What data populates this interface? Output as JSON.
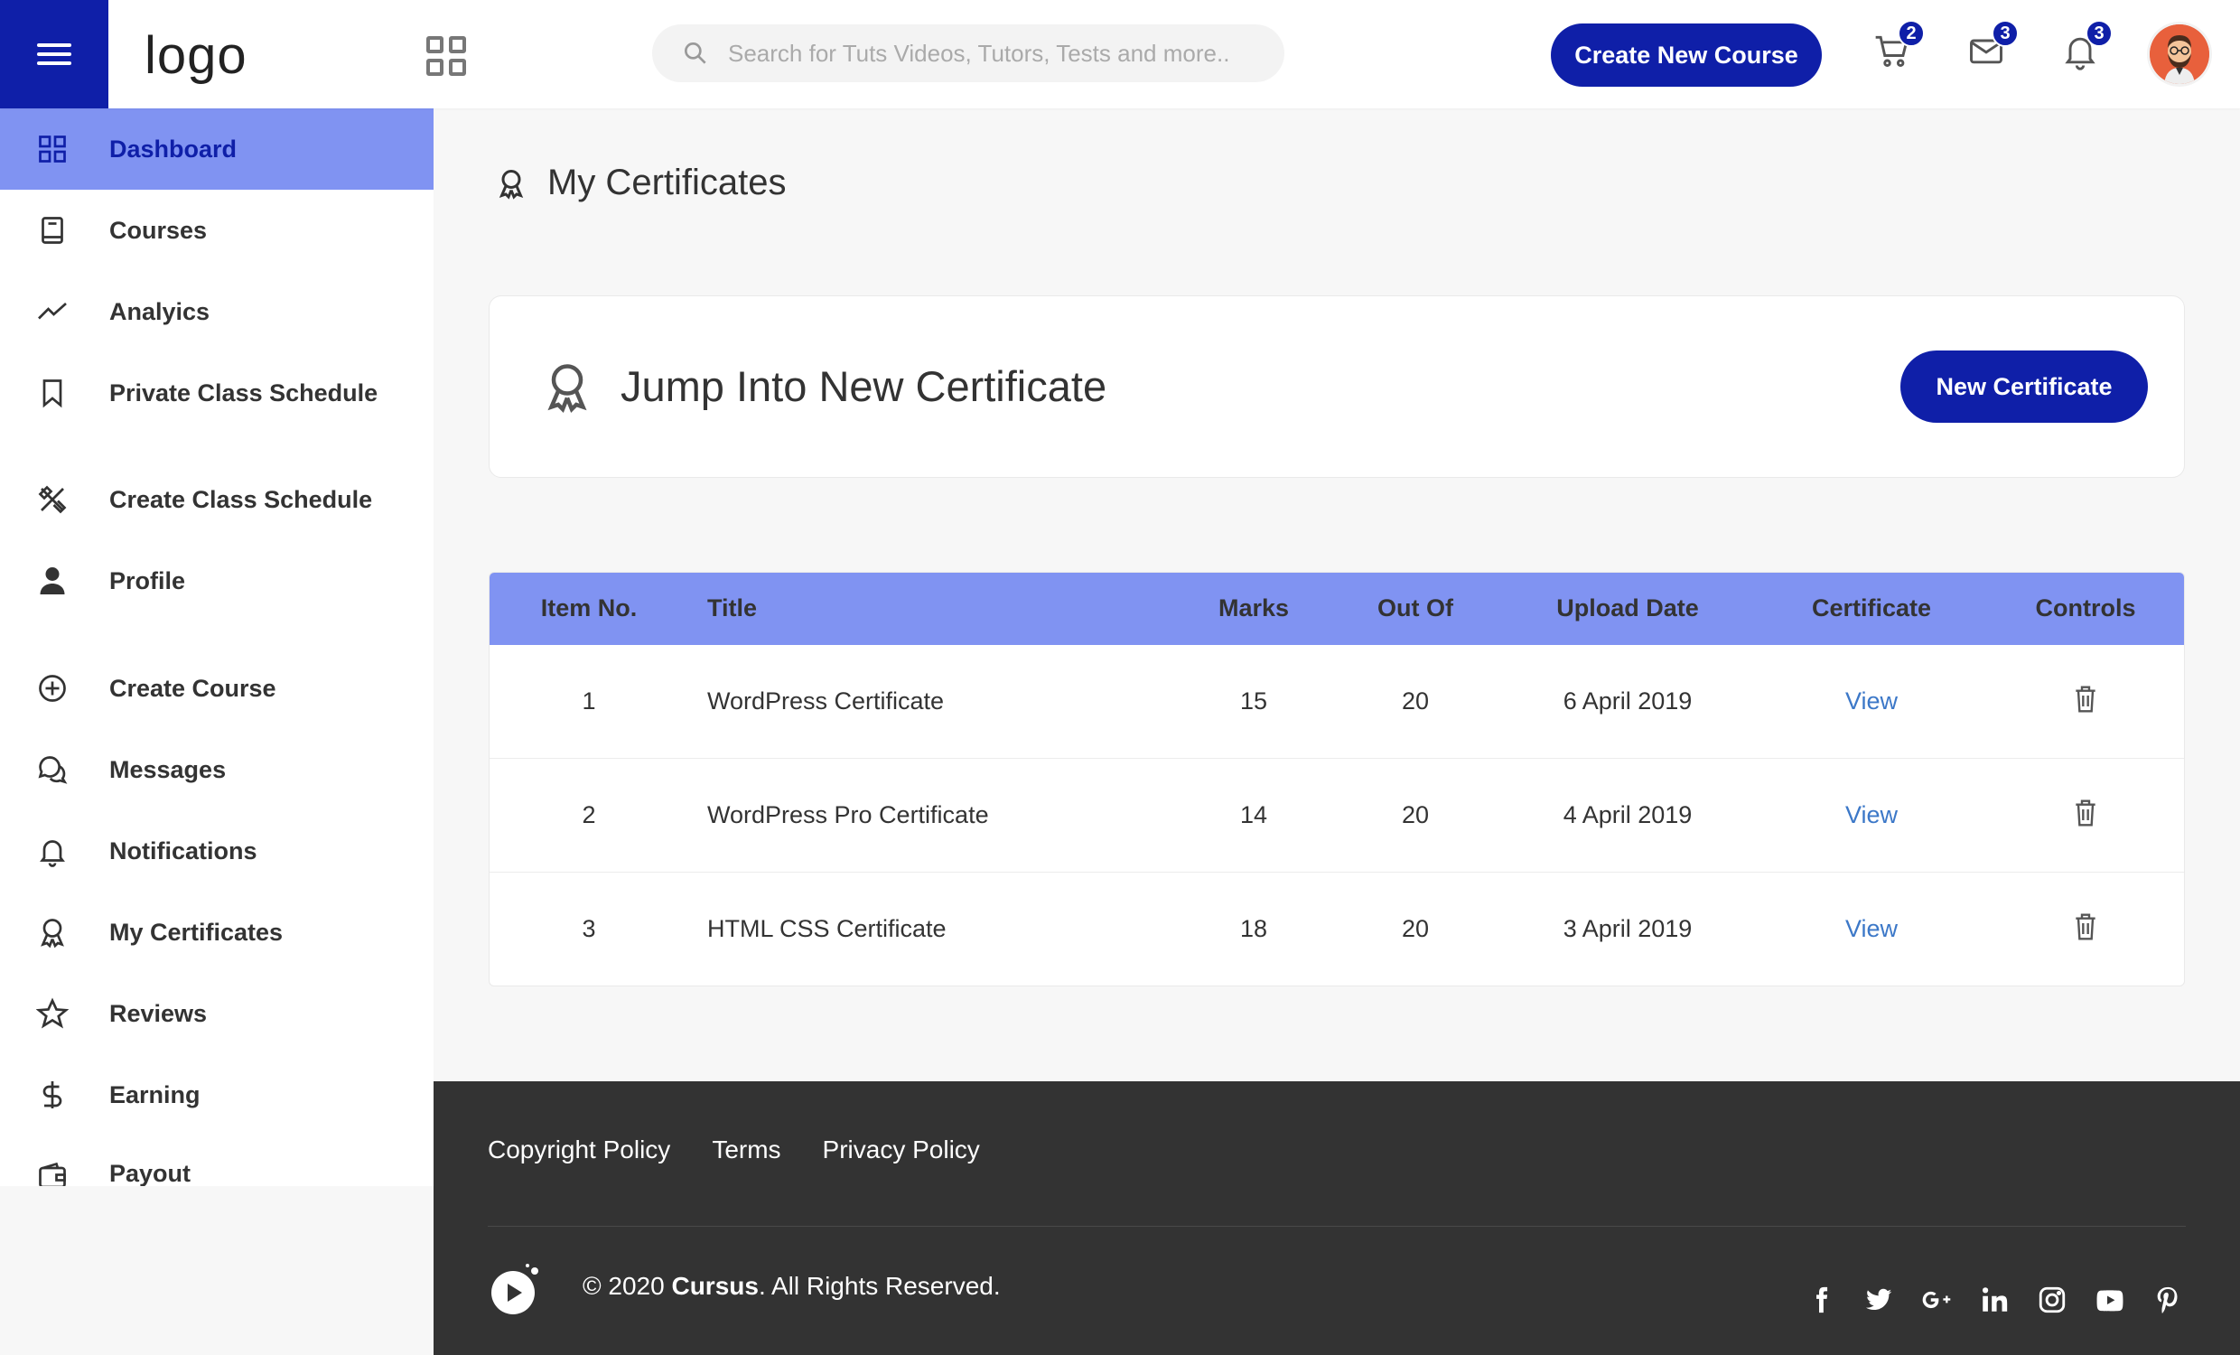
{
  "header": {
    "logo_text": "logo",
    "search_placeholder": "Search for Tuts Videos, Tutors, Tests and more..",
    "create_button": "Create New Course",
    "cart_badge": "2",
    "messages_badge": "3",
    "notifications_badge": "3"
  },
  "sidebar": {
    "items": [
      {
        "label": "Dashboard",
        "icon": "dashboard-icon",
        "active": true
      },
      {
        "label": "Courses",
        "icon": "book-icon"
      },
      {
        "label": "Analyics",
        "icon": "trend-icon"
      },
      {
        "label": "Private Class Schedule",
        "icon": "bookmark-icon"
      },
      {
        "label": "Create Class Schedule",
        "icon": "pen-ruler-icon"
      },
      {
        "label": "Profile",
        "icon": "user-icon"
      },
      {
        "label": "Create Course",
        "icon": "plus-circle-icon"
      },
      {
        "label": "Messages",
        "icon": "chat-icon"
      },
      {
        "label": "Notifications",
        "icon": "bell-icon"
      },
      {
        "label": "My Certificates",
        "icon": "award-icon"
      },
      {
        "label": "Reviews",
        "icon": "star-icon"
      },
      {
        "label": "Earning",
        "icon": "dollar-icon"
      },
      {
        "label": "Payout",
        "icon": "wallet-icon"
      }
    ]
  },
  "main": {
    "page_title": "My Certificates",
    "jump_title": "Jump Into New Certificate",
    "new_certificate_button": "New Certificate",
    "table": {
      "headers": [
        "Item No.",
        "Title",
        "Marks",
        "Out Of",
        "Upload Date",
        "Certificate",
        "Controls"
      ],
      "rows": [
        {
          "no": "1",
          "title": "WordPress Certificate",
          "marks": "15",
          "out_of": "20",
          "date": "6 April 2019",
          "cert": "View"
        },
        {
          "no": "2",
          "title": "WordPress Pro Certificate",
          "marks": "14",
          "out_of": "20",
          "date": "4 April 2019",
          "cert": "View"
        },
        {
          "no": "3",
          "title": "HTML CSS Certificate",
          "marks": "18",
          "out_of": "20",
          "date": "3 April 2019",
          "cert": "View"
        }
      ]
    }
  },
  "footer": {
    "links": [
      "Copyright Policy",
      "Terms",
      "Privacy Policy"
    ],
    "copyright_prefix": "© 2020 ",
    "brand": "Cursus",
    "copyright_suffix": ". All Rights Reserved."
  },
  "colors": {
    "primary": "#0f1fa8",
    "active_highlight": "#8093f2",
    "link": "#3c78c8",
    "footer_bg": "#333333"
  }
}
